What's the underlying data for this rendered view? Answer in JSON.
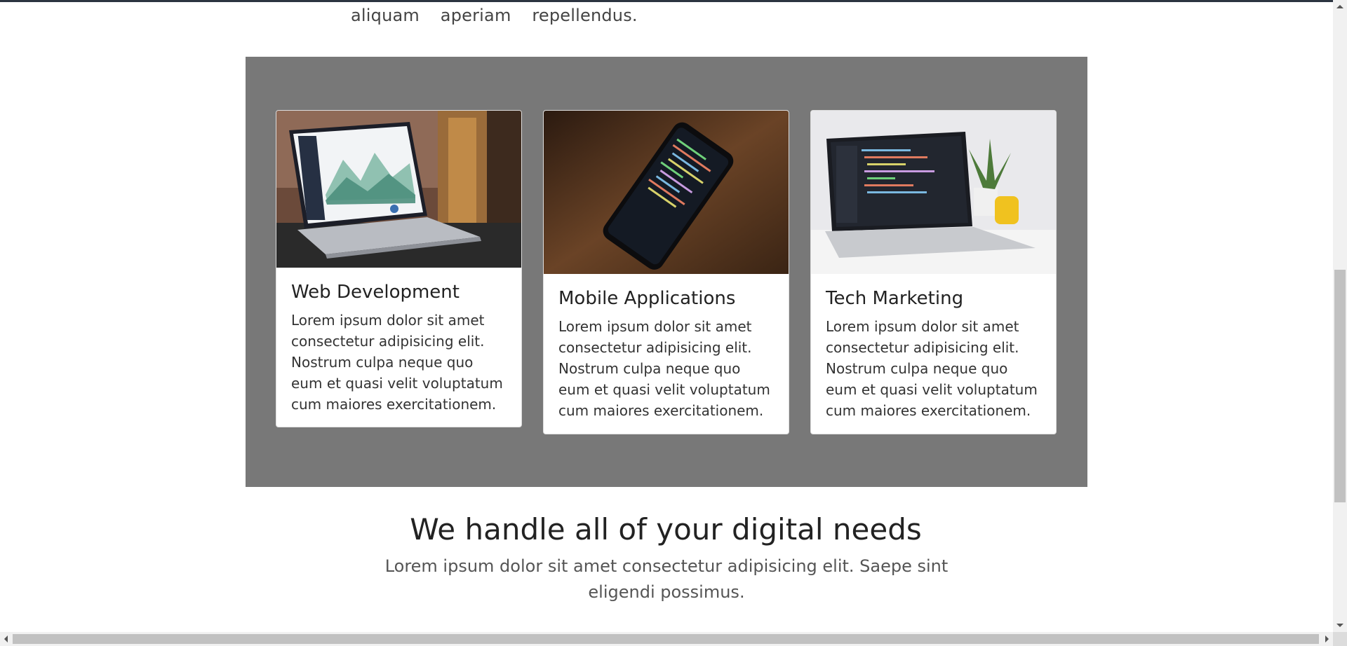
{
  "intro": {
    "tail_text": "aliquam aperiam repellendus."
  },
  "services": {
    "cards": [
      {
        "title": "Web Development",
        "text": "Lorem ipsum dolor sit amet consectetur adipisicing elit. Nostrum culpa neque quo eum et quasi velit voluptatum cum maiores exercitationem.",
        "image_icon": "laptop-analytics-photo"
      },
      {
        "title": "Mobile Applications",
        "text": "Lorem ipsum dolor sit amet consectetur adipisicing elit. Nostrum culpa neque quo eum et quasi velit voluptatum cum maiores exercitationem.",
        "image_icon": "smartphone-code-photo"
      },
      {
        "title": "Tech Marketing",
        "text": "Lorem ipsum dolor sit amet consectetur adipisicing elit. Nostrum culpa neque quo eum et quasi velit voluptatum cum maiores exercitationem.",
        "image_icon": "laptop-code-plant-photo"
      }
    ]
  },
  "digital": {
    "headline": "We handle all of your digital needs",
    "subline": "Lorem ipsum dolor sit amet consectetur adipisicing elit. Saepe sint eligendi possimus."
  },
  "colors": {
    "section_bg": "#787878",
    "page_bg": "#ffffff",
    "text_dark": "#222222"
  }
}
